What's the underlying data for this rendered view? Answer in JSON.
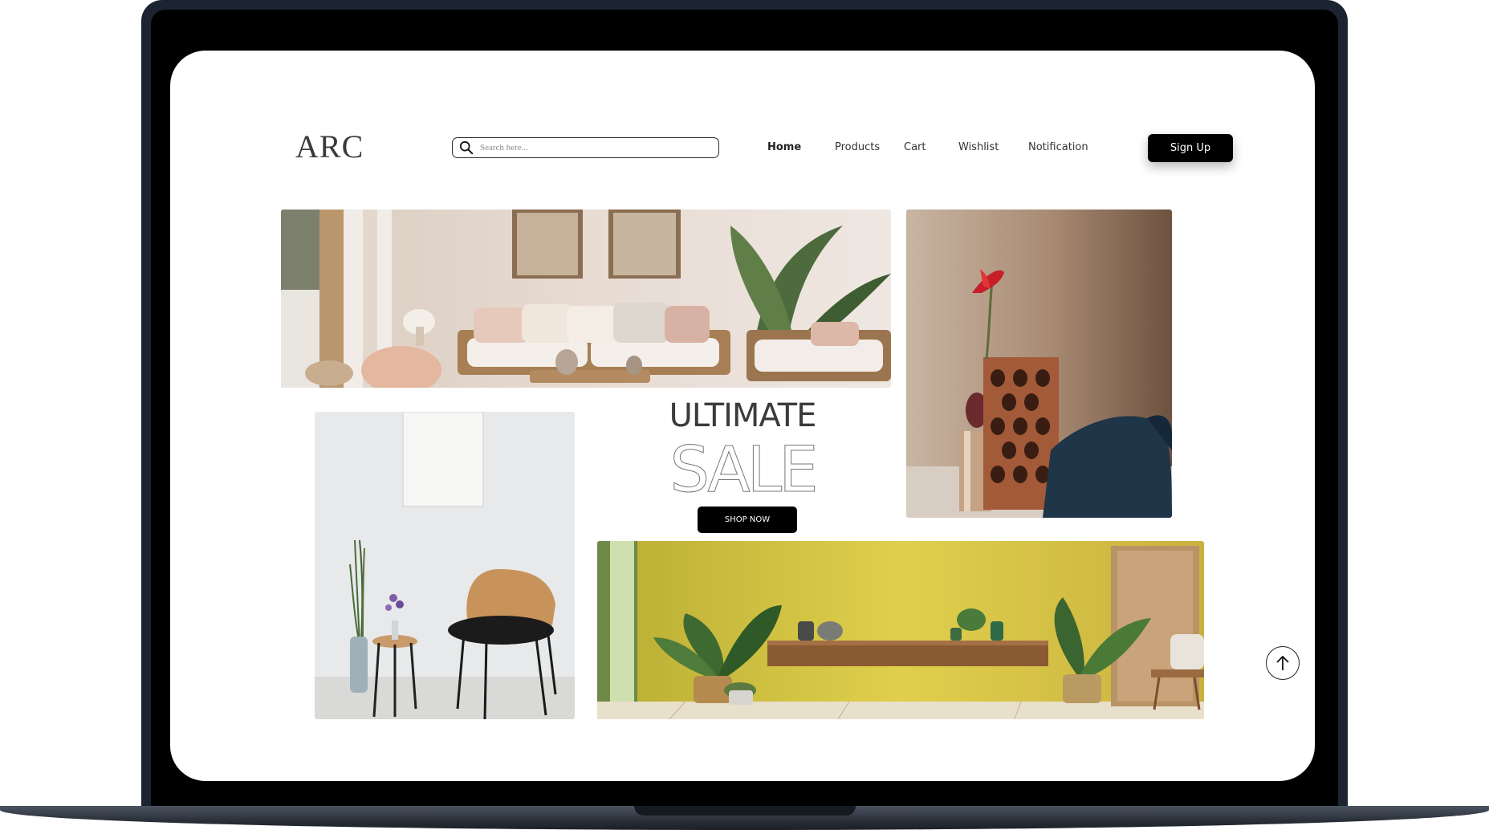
{
  "brand": {
    "logo": "ARC"
  },
  "search": {
    "placeholder": "Search here...",
    "icon": "search-icon"
  },
  "nav": {
    "items": [
      {
        "label": "Home",
        "active": true
      },
      {
        "label": "Products",
        "active": false
      },
      {
        "label": "Cart",
        "active": false
      },
      {
        "label": "Wishlist",
        "active": false
      },
      {
        "label": "Notification",
        "active": false
      }
    ]
  },
  "auth": {
    "signup_label": "Sign Up"
  },
  "hero": {
    "headline": "ULTIMATE",
    "headline_big": "SALE",
    "cta_label": "SHOP NOW"
  },
  "images": [
    {
      "name": "living-room-sofa-photo"
    },
    {
      "name": "brick-vase-flower-photo"
    },
    {
      "name": "chair-side-table-photo"
    },
    {
      "name": "yellow-wall-shelf-photo"
    }
  ],
  "scroll_top": {
    "icon": "arrow-up-icon"
  },
  "colors": {
    "accent": "#000000",
    "text": "#333333",
    "frame": "#1c2431"
  }
}
